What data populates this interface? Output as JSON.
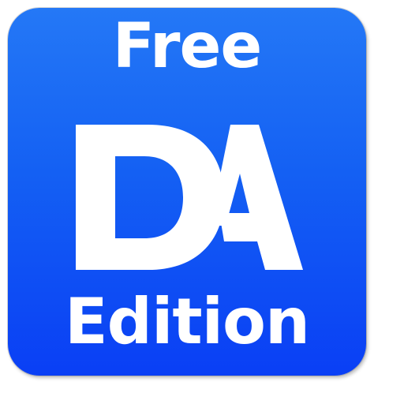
{
  "icon": {
    "top_label": "Free",
    "logo_text": "DA",
    "bottom_label": "Edition"
  },
  "colors": {
    "background_top": "#2478f6",
    "background_bottom": "#0a3ff5",
    "text": "#ffffff"
  }
}
